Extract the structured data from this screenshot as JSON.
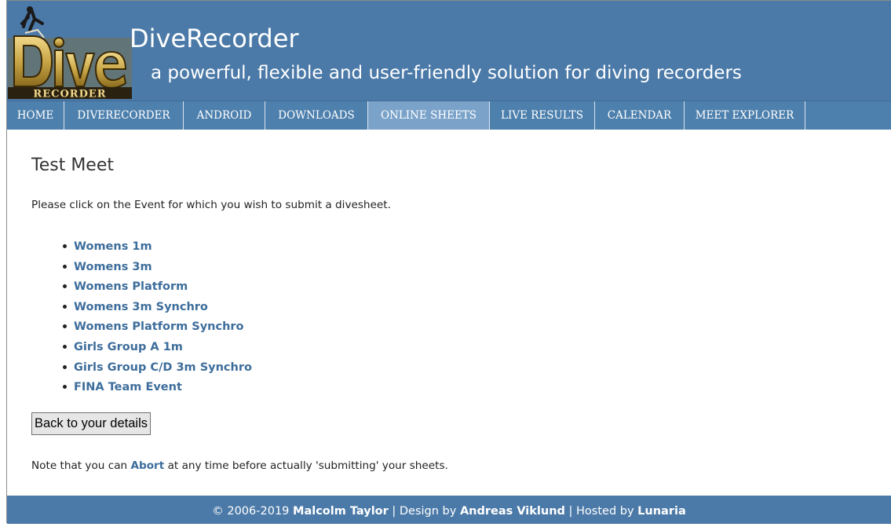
{
  "header": {
    "logo_text": "RECORDER",
    "title": "DiveRecorder",
    "tagline": "a powerful, flexible and user-friendly solution for diving recorders"
  },
  "nav": {
    "items": [
      {
        "label": "HOME",
        "active": false
      },
      {
        "label": "DIVERECORDER",
        "active": false
      },
      {
        "label": "ANDROID",
        "active": false
      },
      {
        "label": "DOWNLOADS",
        "active": false
      },
      {
        "label": "ONLINE SHEETS",
        "active": true
      },
      {
        "label": "LIVE RESULTS",
        "active": false
      },
      {
        "label": "CALENDAR",
        "active": false
      },
      {
        "label": "MEET EXPLORER",
        "active": false
      }
    ]
  },
  "main": {
    "heading": "Test Meet",
    "intro": "Please click on the Event for which you wish to submit a divesheet.",
    "events": [
      "Womens 1m",
      "Womens 3m",
      "Womens Platform",
      "Womens 3m Synchro",
      "Womens Platform Synchro",
      "Girls Group A 1m",
      "Girls Group C/D 3m Synchro",
      "FINA Team Event"
    ],
    "back_button_label": "Back to your details",
    "note_before": "Note that you can ",
    "note_link": "Abort",
    "note_after": " at any time before actually 'submitting' your sheets."
  },
  "footer": {
    "copyright": "© 2006-2019 ",
    "author": "Malcolm Taylor",
    "sep1": " | Design by ",
    "designer": "Andreas Viklund",
    "sep2": " | Hosted by ",
    "host": "Lunaria"
  },
  "colors": {
    "header_bg": "#4c7aa8",
    "nav_active_bg": "#7ba3ca",
    "link": "#3d6d9b"
  }
}
